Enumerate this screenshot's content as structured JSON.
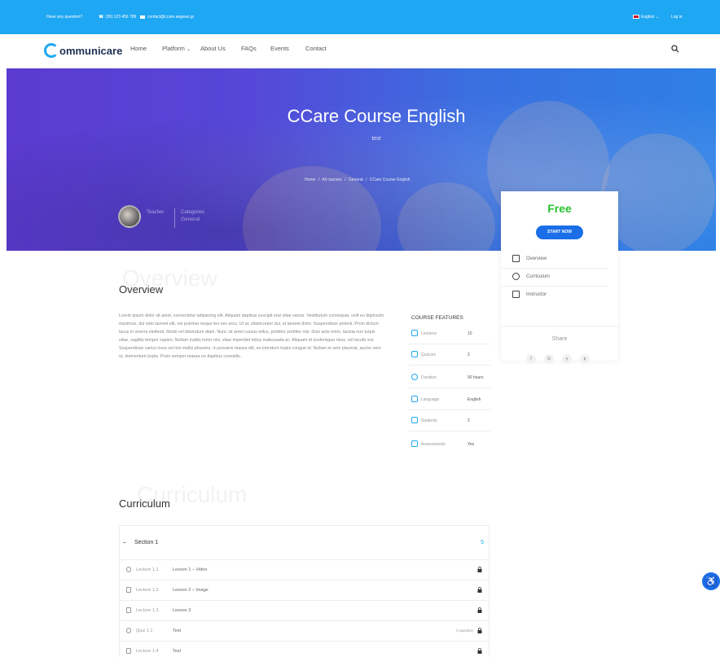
{
  "topbar": {
    "question": "Have any question?",
    "phone": "(30) 123 456 789",
    "email": "contact@ccare.aegean.gr",
    "language": "English",
    "login": "Log in"
  },
  "nav": {
    "logo": "ommunicare",
    "items": [
      "Home",
      "Platform",
      "About Us",
      "FAQs",
      "Events",
      "Contact"
    ]
  },
  "hero": {
    "title": "CCare Course English",
    "subtitle": "test",
    "breadcrumb": [
      "Home",
      "/",
      "All courses",
      "/",
      "General",
      "/",
      "CCare Course English"
    ],
    "teacher_label": "Teacher",
    "category_label": "Categories",
    "category_value": "General"
  },
  "card": {
    "price": "Free",
    "start": "START NOW",
    "links": [
      "Overview",
      "Curriculum",
      "Instructor"
    ],
    "share": "Share",
    "social": [
      "f",
      "G",
      "y",
      "p"
    ]
  },
  "overview": {
    "ghost": "Overview",
    "title": "Overview",
    "text": "Lorem ipsum dolor sit amet, consectetur adipiscing elit. Aliquam dapibus suscipit erat vitae varius. Vestibulum consequat, velit eu dignissim maximus, dui odio laoreet elit, vel pulvinar neque leo nec arcu. Ut ac ullamcorper dui, et laoreet dolor. Suspendisse potenti. Proin dictum lacus in viverra eleifend. Morbi vel bibendum diam. Nunc sit amet cursus tellus, porttitor porttitor nisi. Duis ante enim, lacinia non turpis vitae, sagittis tempor sapien. Nullam mattis tortor nisi, vitae imperdiet tellus malesuada ac. Aliquam id scelerisque risus, vel iaculis est. Suspendisse varius risus vel nisi mollis pharetra. In posuere massa elit, eu interdum turpis congue id. Nullam et sem placerat, auctor sem ut, elementum turpis. Proin semper massa eu dapibus convallis."
  },
  "features": {
    "title": "COURSE FEATURES",
    "rows": [
      {
        "label": "Lectures",
        "value": "10"
      },
      {
        "label": "Quizzes",
        "value": "2"
      },
      {
        "label": "Duration",
        "value": "50 hours"
      },
      {
        "label": "Language",
        "value": "English"
      },
      {
        "label": "Students",
        "value": "2"
      },
      {
        "label": "Assessments",
        "value": "Yes"
      }
    ]
  },
  "curriculum": {
    "ghost": "Curriculum",
    "title": "Curriculum",
    "section_title": "Section 1",
    "section_count": "5",
    "lessons": [
      {
        "num": "Lecture 1.1",
        "name": "Lesson 1 – Video",
        "extra": ""
      },
      {
        "num": "Lecture 1.2",
        "name": "Lesson 2 – Image",
        "extra": ""
      },
      {
        "num": "Lecture 1.3",
        "name": "Lesson 3",
        "extra": ""
      },
      {
        "num": "Quiz 1.1",
        "name": "Test",
        "extra": "0 question"
      },
      {
        "num": "Lecture 1.4",
        "name": "Test",
        "extra": ""
      }
    ]
  },
  "colors": {
    "topbar": "#1ea7f2",
    "price": "#27c22f",
    "button": "#1a6ee8"
  }
}
